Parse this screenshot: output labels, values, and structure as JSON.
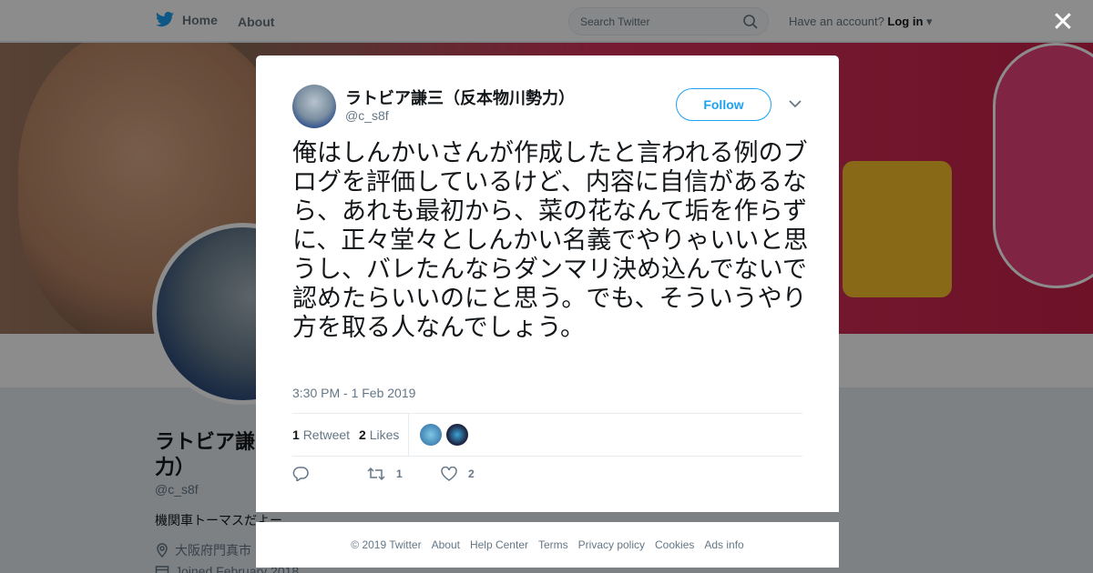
{
  "nav": {
    "home_label": "Home",
    "about_label": "About",
    "search_placeholder": "Search Twitter",
    "account_prompt": "Have an account?",
    "login_label": "Log in"
  },
  "background_profile": {
    "name_line1": "ラトビア謙",
    "name_line2": "力）",
    "handle": "@c_s8f",
    "bio": "機関車トーマスだよー",
    "location": "大阪府門真市",
    "joined": "Joined February 2018"
  },
  "tweet": {
    "author_name": "ラトビア謙三（反本物川勢力）",
    "author_handle": "@c_s8f",
    "follow_label": "Follow",
    "text": "俺はしんかいさんが作成したと言われる例のブログを評価しているけど、内容に自信があるなら、あれも最初から、菜の花なんて垢を作らずに、正々堂々としんかい名義でやりゃいいと思うし、バレたんならダンマリ決め込んでないで認めたらいいのにと思う。でも、そういうやり方を取る人なんでしょう。",
    "timestamp": "3:30 PM - 1 Feb 2019",
    "retweet_count": "1",
    "retweet_label": "Retweet",
    "likes_count": "2",
    "likes_label": "Likes",
    "action_retweet_count": "1",
    "action_like_count": "2"
  },
  "footer": {
    "links": [
      "© 2019 Twitter",
      "About",
      "Help Center",
      "Terms",
      "Privacy policy",
      "Cookies",
      "Ads info"
    ]
  },
  "colors": {
    "accent": "#1da1f2",
    "muted": "#657786"
  }
}
